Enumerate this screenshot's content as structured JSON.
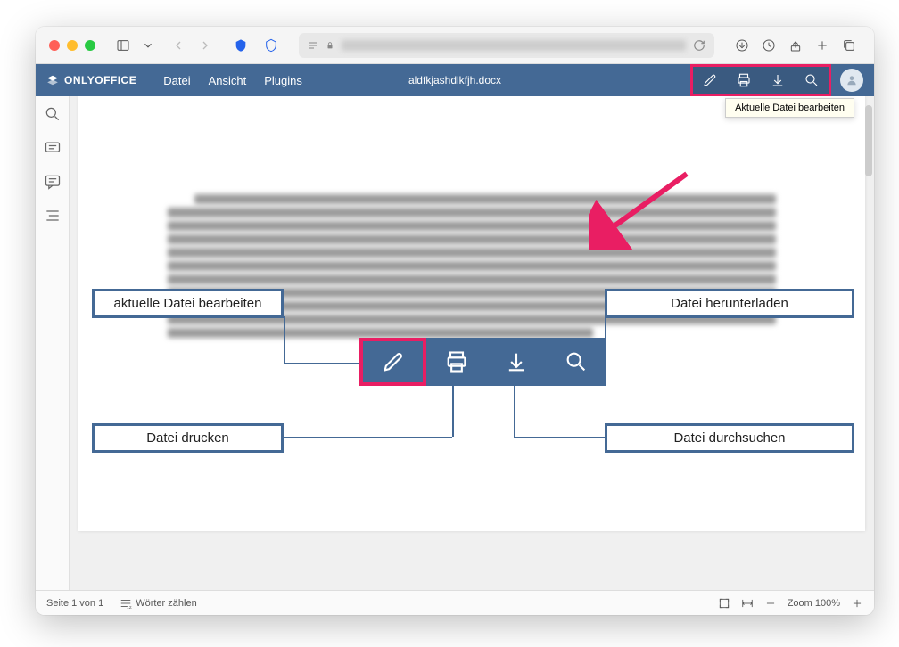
{
  "browser": {
    "url_display": ""
  },
  "app": {
    "brand": "ONLYOFFICE",
    "menu": {
      "file": "Datei",
      "view": "Ansicht",
      "plugins": "Plugins"
    },
    "filename": "aldfkjashdlkfjh.docx",
    "tooltip": "Aktuelle Datei bearbeiten",
    "status": {
      "page": "Seite 1 von 1",
      "wordcount": "Wörter zählen",
      "zoom": "Zoom 100%"
    }
  },
  "callouts": {
    "edit": "aktuelle Datei bearbeiten",
    "download": "Datei herunterladen",
    "print": "Datei drucken",
    "search": "Datei durchsuchen"
  },
  "icons": {
    "edit": "pencil-icon",
    "print": "printer-icon",
    "download": "download-icon",
    "search": "search-icon"
  }
}
